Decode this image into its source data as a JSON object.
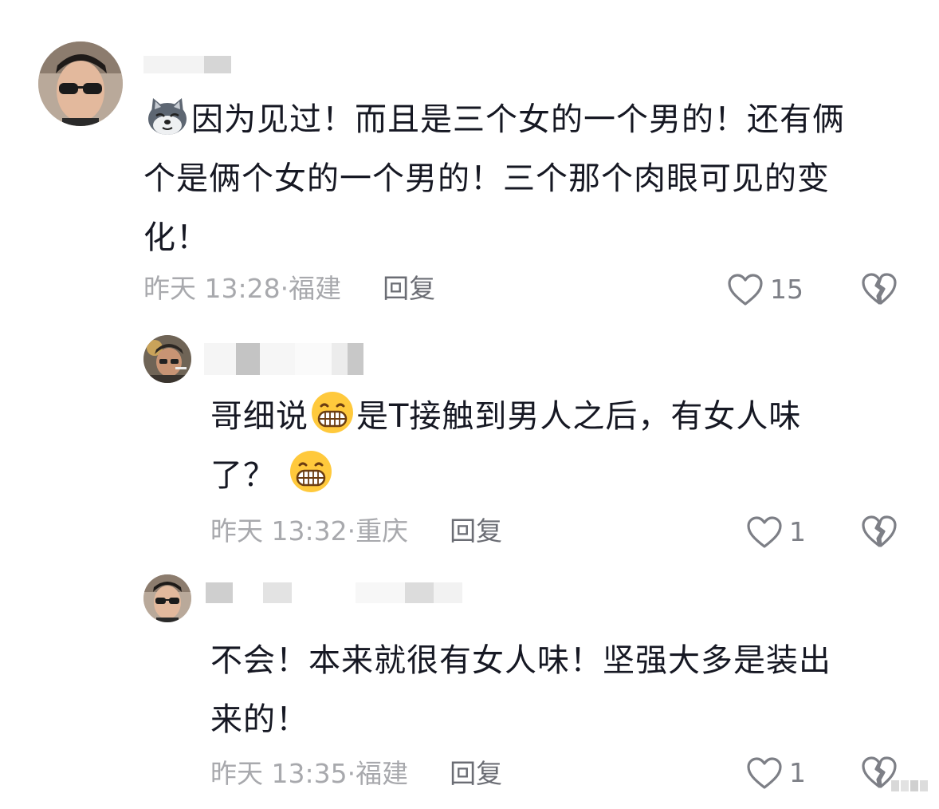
{
  "comments": [
    {
      "text": "因为见过！而且是三个女的一个男的！还有俩个是俩个女的一个男的！三个那个肉眼可见的变化！",
      "lines": [
        "因为见过！而且是三个女的一个男的！还有俩",
        "个是俩个女的一个男的！三个那个肉眼可见的变",
        "化！"
      ],
      "prefix_emoji": "wolf-emoji",
      "time": "昨天 13:28",
      "location": "福建",
      "reply_label": "回复",
      "likes": "15"
    },
    {
      "line1_a": "哥细说",
      "line1_b": "是T接触到男人之后，有女人味",
      "line2": "了？",
      "emoji": "grin-emoji",
      "time": "昨天 13:32",
      "location": "重庆",
      "reply_label": "回复",
      "likes": "1"
    },
    {
      "lines": [
        "不会！本来就很有女人味！坚强大多是装出",
        "来的！"
      ],
      "time": "昨天 13:35",
      "location": "福建",
      "reply_label": "回复",
      "likes": "1"
    }
  ],
  "colors": {
    "text": "#161823",
    "meta": "#a8a9ad",
    "reply": "#6b6d74",
    "icon": "#7d7f86"
  }
}
